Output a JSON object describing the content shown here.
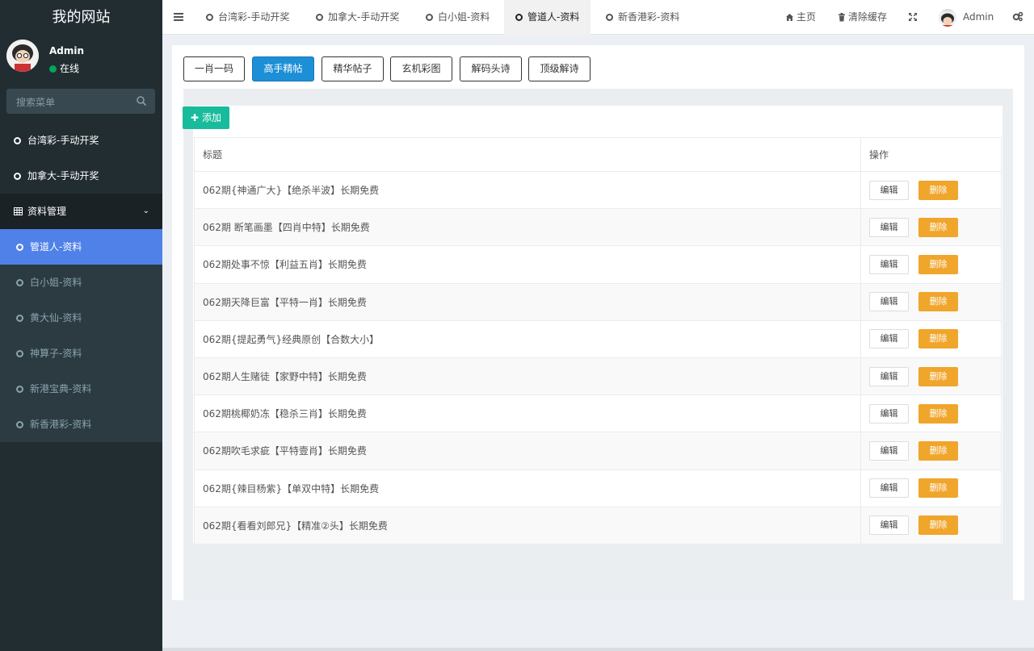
{
  "site": {
    "title": "我的网站"
  },
  "user": {
    "name": "Admin",
    "status": "在线"
  },
  "search": {
    "placeholder": "搜索菜单"
  },
  "sidebar": {
    "items": [
      {
        "label": "台湾彩-手动开奖"
      },
      {
        "label": "加拿大-手动开奖"
      }
    ],
    "group": {
      "label": "资料管理"
    },
    "sub_items": [
      {
        "label": "管道人-资料",
        "active": true
      },
      {
        "label": "白小姐-资料"
      },
      {
        "label": "黄大仙-资料"
      },
      {
        "label": "神算子-资料"
      },
      {
        "label": "新港宝典-资料"
      },
      {
        "label": "新香港彩-资料"
      }
    ]
  },
  "tabs": [
    {
      "label": "台湾彩-手动开奖"
    },
    {
      "label": "加拿大-手动开奖"
    },
    {
      "label": "白小姐-资料"
    },
    {
      "label": "管道人-资料",
      "active": true
    },
    {
      "label": "新香港彩-资料"
    }
  ],
  "topbar": {
    "home": "主页",
    "clear_cache": "清除缓存",
    "admin": "Admin"
  },
  "page_buttons": [
    {
      "label": "一肖一码"
    },
    {
      "label": "高手精帖",
      "active": true
    },
    {
      "label": "精华帖子"
    },
    {
      "label": "玄机彩图"
    },
    {
      "label": "解码头诗"
    },
    {
      "label": "顶级解诗"
    }
  ],
  "add_button": "添加",
  "table": {
    "headers": {
      "title": "标题",
      "action": "操作"
    },
    "edit_label": "编辑",
    "delete_label": "删除",
    "rows": [
      "062期{神通广大}【绝杀半波】长期免费",
      "062期 断笔画墨【四肖中特】长期免费",
      "062期处事不惊【利益五肖】长期免费",
      "062期天降巨富【平特一肖】长期免费",
      "062期{提起勇气}经典原创【合数大小】",
      "062期人生赌徒【家野中特】长期免费",
      "062期桃椰奶冻【稳杀三肖】长期免费",
      "062期吹毛求疵【平特壹肖】长期免费",
      "062期{辣目杨紫}【单双中特】长期免费",
      "062期{看看刘郎兄}【精准②头】长期免费"
    ]
  },
  "colors": {
    "sidebar_bg": "#222d32",
    "active_menu": "#4f81e8",
    "primary": "#1c8fd6",
    "success": "#18bc9c",
    "warning": "#f0a52b"
  }
}
